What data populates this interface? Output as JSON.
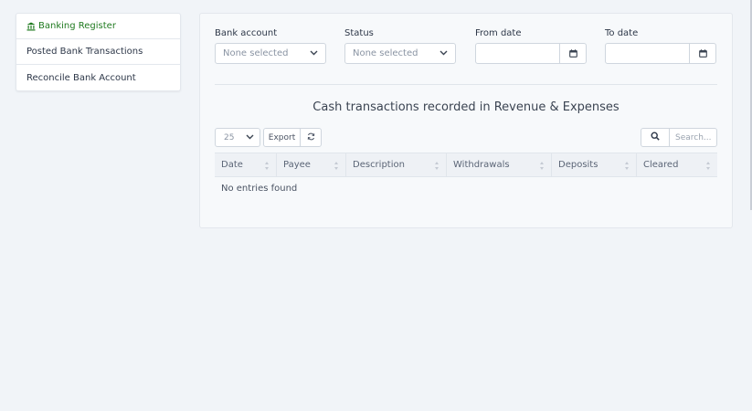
{
  "sidebar": {
    "items": [
      {
        "label": "Banking Register",
        "active": true,
        "icon": "bank-icon"
      },
      {
        "label": "Posted Bank Transactions"
      },
      {
        "label": "Reconcile Bank Account"
      }
    ]
  },
  "filters": {
    "bank_account": {
      "label": "Bank account",
      "value": "None selected"
    },
    "status": {
      "label": "Status",
      "value": "None selected"
    },
    "from_date": {
      "label": "From date",
      "value": ""
    },
    "to_date": {
      "label": "To date",
      "value": ""
    }
  },
  "caption": "Cash transactions recorded in Revenue & Expenses",
  "table_controls": {
    "page_length": "25",
    "export_label": "Export",
    "search_placeholder": "Search..."
  },
  "table": {
    "columns": [
      "Date",
      "Payee",
      "Description",
      "Withdrawals",
      "Deposits",
      "Cleared"
    ],
    "empty_message": "No entries found"
  },
  "colors": {
    "accent_green": "#1f7a1f",
    "page_background": "#f1f4f8"
  }
}
